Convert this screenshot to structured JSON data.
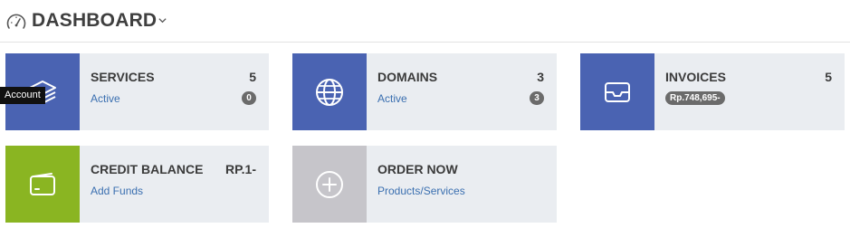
{
  "header": {
    "title": "DASHBOARD",
    "icon": "gauge-icon"
  },
  "cards": {
    "services": {
      "label": "SERVICES",
      "count": "5",
      "link": "Active",
      "badge": "0",
      "icon": "layers-icon",
      "color": "#4a63b2"
    },
    "domains": {
      "label": "DOMAINS",
      "count": "3",
      "link": "Active",
      "badge": "3",
      "icon": "globe-icon",
      "color": "#4a63b2"
    },
    "invoices": {
      "label": "INVOICES",
      "count": "5",
      "badge": "Rp.748,695-",
      "icon": "inbox-icon",
      "color": "#4a63b2"
    },
    "credit": {
      "label": "CREDIT BALANCE",
      "count": "RP.1-",
      "link": "Add Funds",
      "icon": "wallet-icon",
      "color": "#8ab522"
    },
    "order": {
      "label": "ORDER NOW",
      "link": "Products/Services",
      "icon": "plus-circle-icon",
      "color": "#c6c5ca"
    }
  },
  "tooltip": {
    "text": "Account"
  }
}
